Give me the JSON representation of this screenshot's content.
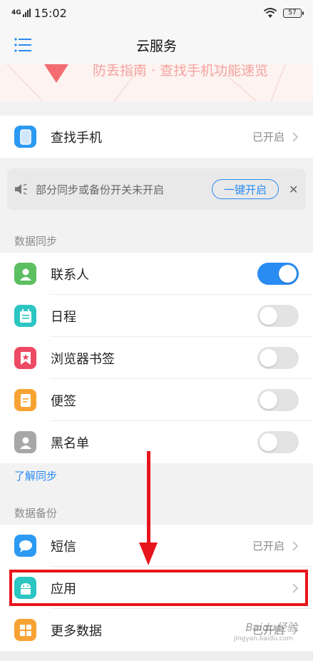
{
  "status_bar": {
    "network": "4G",
    "time": "15:02",
    "battery": "57"
  },
  "header": {
    "title": "云服务"
  },
  "banner": {
    "text": "防丢指南 · 查找手机功能速览"
  },
  "find_phone": {
    "label": "查找手机",
    "status": "已开启"
  },
  "notice": {
    "text": "部分同步或备份开关未开启",
    "button": "一键开启",
    "close": "✕"
  },
  "sync": {
    "title": "数据同步",
    "items": [
      {
        "label": "联系人",
        "on": true
      },
      {
        "label": "日程",
        "on": false
      },
      {
        "label": "浏览器书签",
        "on": false
      },
      {
        "label": "便签",
        "on": false
      },
      {
        "label": "黑名单",
        "on": false
      }
    ],
    "learn_more": "了解同步"
  },
  "backup": {
    "title": "数据备份",
    "items": [
      {
        "label": "短信",
        "status": "已开启"
      },
      {
        "label": "应用",
        "status": ""
      },
      {
        "label": "更多数据",
        "status": "已开启"
      }
    ]
  },
  "watermark": {
    "text": "Baidu经验",
    "sub": "jingyan.baidu.com"
  },
  "colors": {
    "accent": "#2a8bf2",
    "highlight": "#e8141c"
  },
  "icons": {
    "find_phone": "phone-icon",
    "contacts": "contact-icon",
    "calendar": "calendar-icon",
    "bookmarks": "bookmark-icon",
    "notes": "note-icon",
    "blacklist": "blacklist-icon",
    "sms": "message-icon",
    "apps": "android-icon",
    "more": "grid-icon"
  }
}
